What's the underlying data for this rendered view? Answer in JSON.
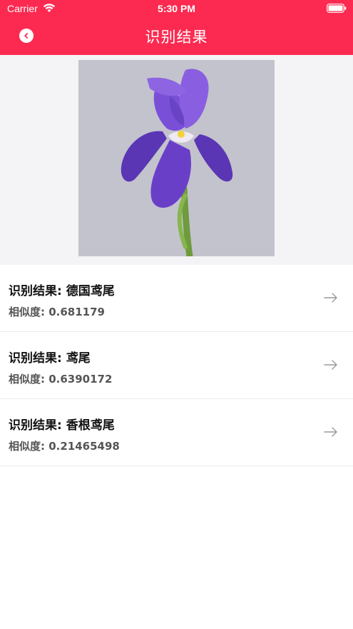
{
  "status_bar": {
    "carrier": "Carrier",
    "time": "5:30 PM",
    "wifi_icon": "wifi-icon",
    "battery_icon": "battery-icon"
  },
  "header": {
    "title": "识别结果",
    "back_icon": "chevron-left-icon",
    "background_color": "#fc2a50"
  },
  "photo": {
    "subject": "purple iris flower"
  },
  "results": [
    {
      "name": "识别结果: 德国鸢尾",
      "score": "相似度: 0.681179"
    },
    {
      "name": "识别结果: 鸢尾",
      "score": "相似度: 0.6390172"
    },
    {
      "name": "识别结果: 香根鸢尾",
      "score": "相似度: 0.21465498"
    }
  ]
}
